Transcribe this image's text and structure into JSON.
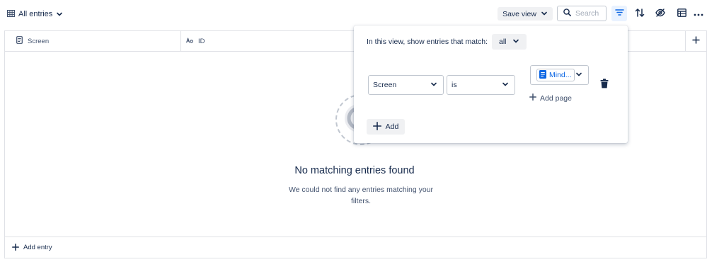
{
  "toolbar": {
    "view_label": "All entries",
    "save_view_label": "Save view",
    "search_placeholder": "Search"
  },
  "icons": {
    "view": "table-grid-icon",
    "chevron": "chevron-down-icon",
    "search": "search-icon",
    "filter": "filter-icon",
    "sort": "sort-icon",
    "hide": "eye-hide-icon",
    "layout": "table-layout-icon",
    "more": "more-icon",
    "add": "plus-icon",
    "page": "page-icon",
    "delete": "trash-icon",
    "text": "text-field-icon"
  },
  "colors": {
    "accent": "#0c66e4",
    "active_bg": "#e9f2ff",
    "border": "#dfe1e6",
    "text": "#172b4d"
  },
  "table": {
    "columns": [
      "Screen",
      "ID"
    ],
    "empty_title": "No matching entries found",
    "empty_description": "We could not find any entries matching your filters.",
    "footer_add_label": "Add entry"
  },
  "filter": {
    "intro_text": "In this view, show entries that match:",
    "match_value": "all",
    "field_value": "Screen",
    "operator_value": "is",
    "page_value": "Mind...",
    "add_page_label": "Add page",
    "add_label": "Add"
  }
}
